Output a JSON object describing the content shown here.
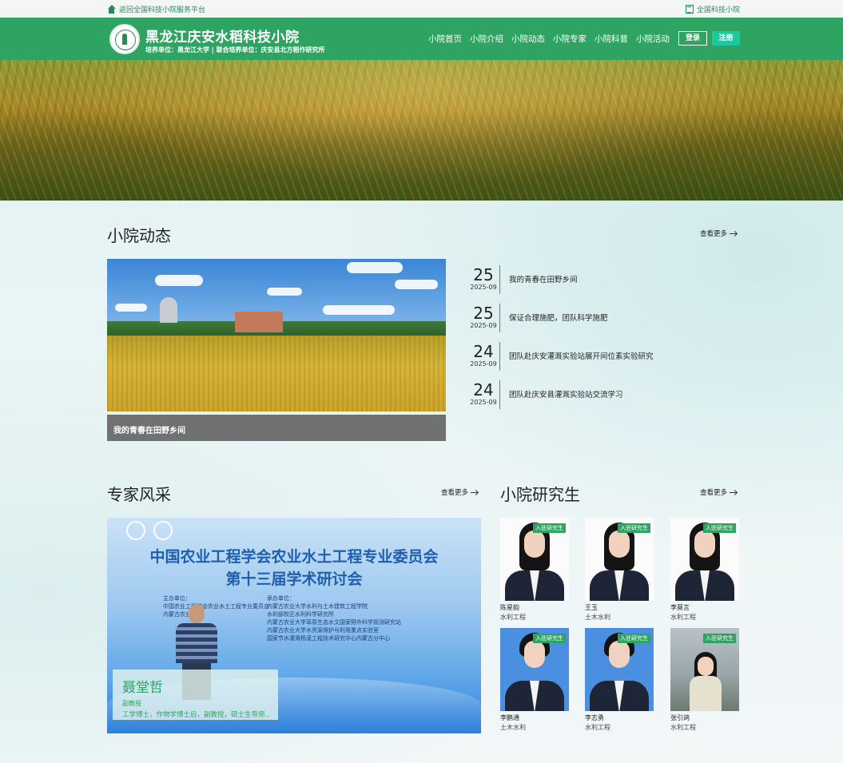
{
  "topbar": {
    "back_label": "返回全国科技小院服务平台",
    "right_label": "全国科技小院"
  },
  "header": {
    "title": "黑龙江庆安水稻科技小院",
    "subtitle": "培养单位：黑龙江大学 | 联合培养单位：庆安县北方稻作研究所",
    "nav": [
      "小院首页",
      "小院介绍",
      "小院动态",
      "小院专家",
      "小院科普",
      "小院活动"
    ],
    "login": "登录",
    "register": "注册"
  },
  "news": {
    "title": "小院动态",
    "more": "查看更多",
    "featured_caption": "我的青春在田野乡间",
    "items": [
      {
        "day": "25",
        "ym": "2025-09",
        "title": "我的青春在田野乡间"
      },
      {
        "day": "25",
        "ym": "2025-09",
        "title": "保证合理施肥，团队科学施肥"
      },
      {
        "day": "24",
        "ym": "2025-09",
        "title": "团队赴庆安灌溉实验站展开间位素实验研究"
      },
      {
        "day": "24",
        "ym": "2025-09",
        "title": "团队赴庆安县灌溉实验站交流学习"
      }
    ]
  },
  "experts": {
    "title": "专家风采",
    "more": "查看更多",
    "poster_line1": "中国农业工程学会农业水土工程专业委员会",
    "poster_line2": "第十三届学术研讨会",
    "poster_left": [
      "主办单位：",
      "中国农业工程学会农业水土工程专业委员会",
      "内蒙古农业大学"
    ],
    "poster_right": [
      "承办单位：",
      "内蒙古农业大学水利与土木建筑工程学院",
      "水利部牧区水利科学研究所",
      "内蒙古农业大学草原生态水文国家野外科学观测研究站",
      "内蒙古农业大学水资源保护与利用重点实验室",
      "国家节水灌溉杨凌工程技术研究中心内蒙古分中心"
    ],
    "name": "聂堂哲",
    "position": "副教授",
    "desc": "工学博士，作物学博士后，副教授，硕士生导师..."
  },
  "students": {
    "title": "小院研究生",
    "more": "查看更多",
    "tag": "入驻研究生",
    "list": [
      {
        "name": "陈星韵",
        "major": "水利工程",
        "bg": "white"
      },
      {
        "name": "王玉",
        "major": "土木水利",
        "bg": "white"
      },
      {
        "name": "李莫言",
        "major": "水利工程",
        "bg": "white"
      },
      {
        "name": "李鹏通",
        "major": "土木水利",
        "bg": "blue"
      },
      {
        "name": "李志勇",
        "major": "水利工程",
        "bg": "blue"
      },
      {
        "name": "张引鸽",
        "major": "水利工程",
        "bg": "lake"
      }
    ]
  },
  "colors": {
    "brand": "#2fa462",
    "accent": "#1bc9a0"
  }
}
